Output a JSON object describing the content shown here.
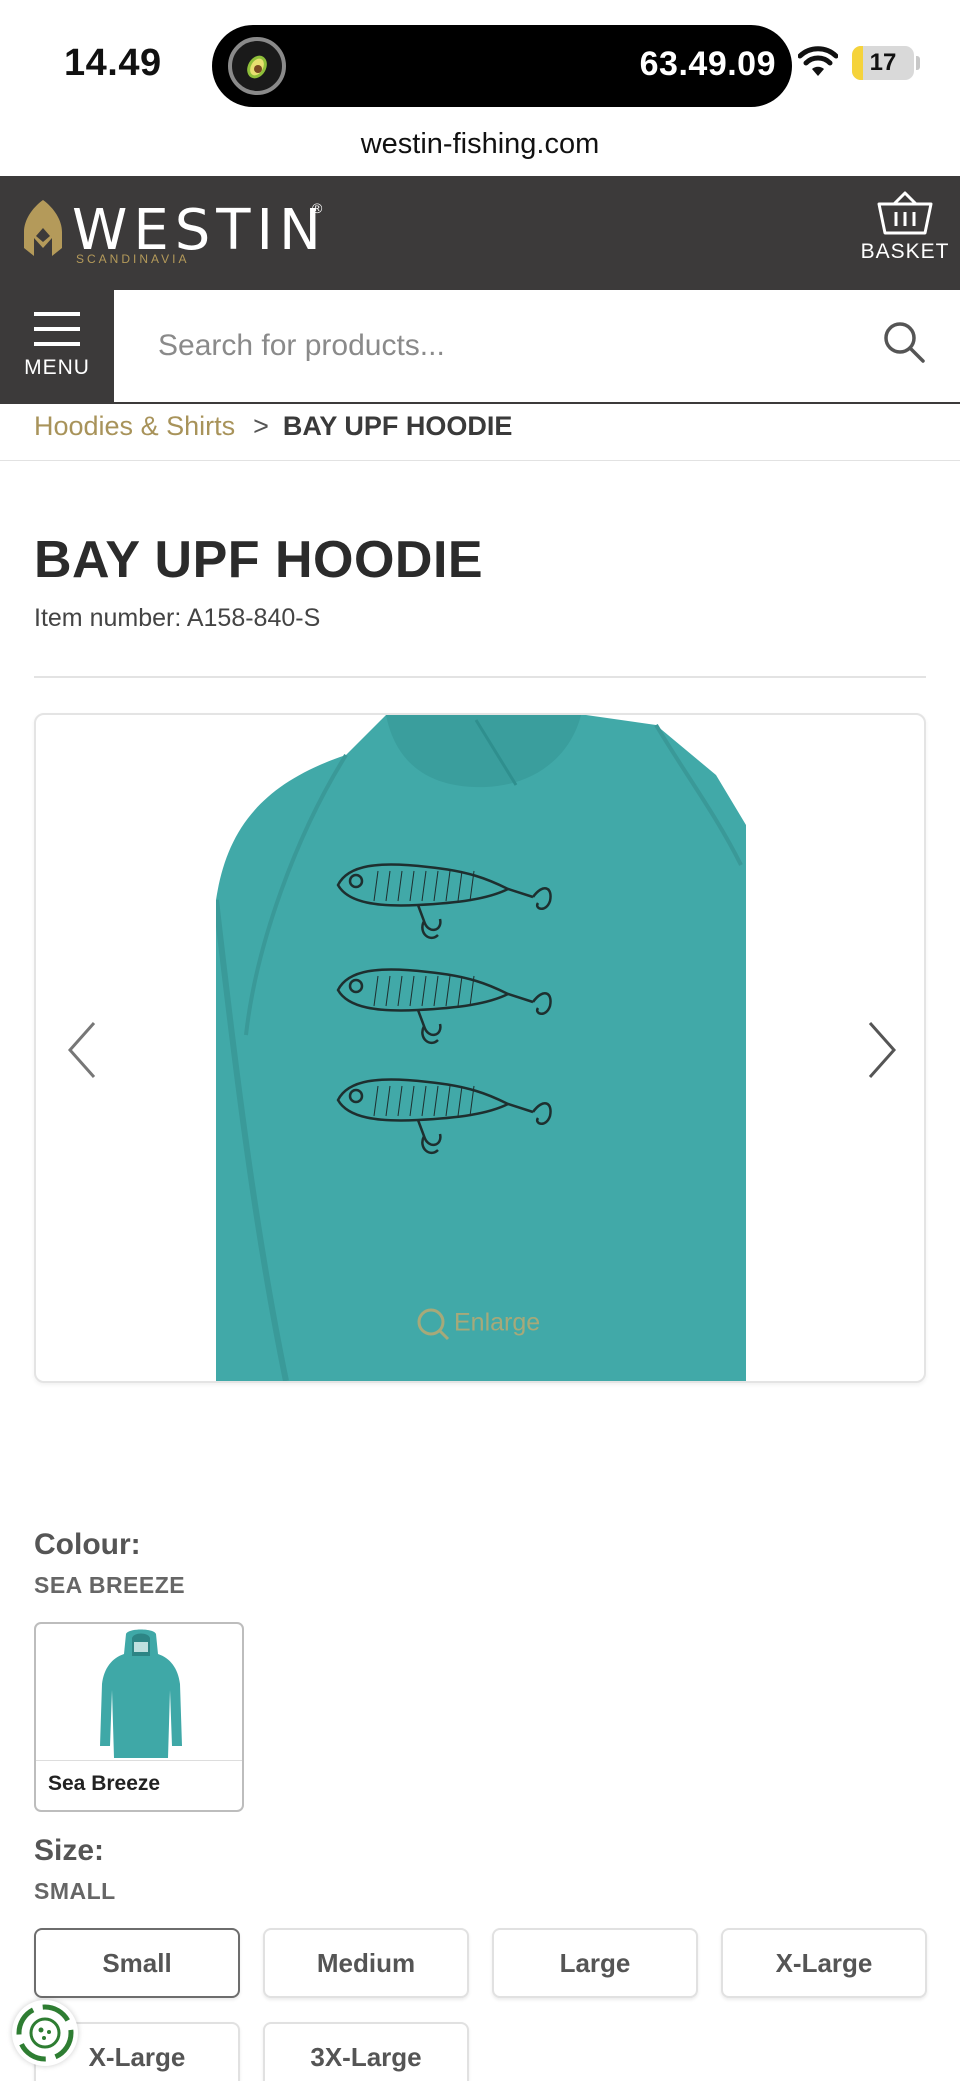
{
  "status_bar": {
    "time": "14.49",
    "timer": "63.49.09",
    "battery_level": "17",
    "battery_fraction": 0.17,
    "timer_app_icon": "avocado-icon",
    "wifi_icon": "wifi-icon"
  },
  "browser": {
    "url": "westin-fishing.com"
  },
  "header": {
    "brand": "WESTIN",
    "brand_sub": "SCANDINAVIA",
    "basket_label": "BASKET",
    "menu_label": "MENU",
    "search_placeholder": "Search for products...",
    "brand_gold": "#b49a5a",
    "header_bg": "#3c3a3a"
  },
  "breadcrumb": {
    "parent": "Hoodies & Shirts",
    "separator": ">",
    "current": "BAY UPF HOODIE"
  },
  "product": {
    "title": "BAY UPF HOODIE",
    "item_number": "Item number: A158-840-S",
    "enlarge_label": "Enlarge",
    "image_color": "#41a9a8",
    "image_subject": "hoodie back print with three fishing lures"
  },
  "colour": {
    "label": "Colour:",
    "selected": "SEA BREEZE",
    "options": [
      {
        "label": "Sea Breeze"
      }
    ]
  },
  "size": {
    "label": "Size:",
    "selected": "SMALL",
    "options": [
      "Small",
      "Medium",
      "Large",
      "X-Large",
      "X-Large",
      "3X-Large"
    ]
  }
}
